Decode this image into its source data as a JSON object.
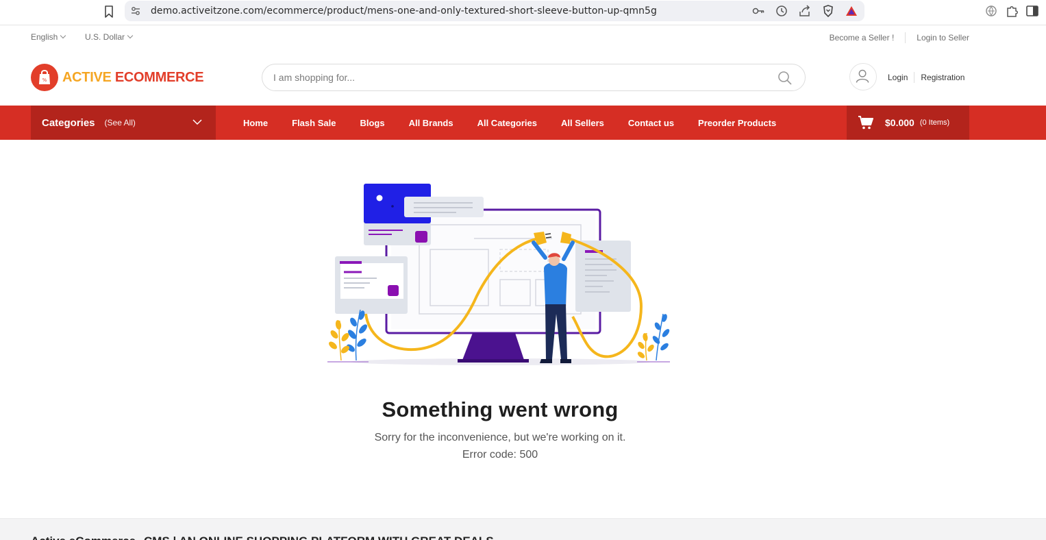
{
  "browser": {
    "url": "demo.activeitzone.com/ecommerce/product/mens-one-and-only-textured-short-sleeve-button-up-qmn5g"
  },
  "topbar": {
    "language": "English",
    "currency": "U.S. Dollar",
    "become_seller": "Become a Seller !",
    "login_seller": "Login to Seller"
  },
  "header": {
    "logo_part1": "ACTIVE",
    "logo_part2": "ECOMMERCE",
    "search_placeholder": "I am shopping for...",
    "login": "Login",
    "registration": "Registration"
  },
  "nav": {
    "categories_title": "Categories",
    "categories_see_all": "(See All)",
    "items": [
      "Home",
      "Flash Sale",
      "Blogs",
      "All Brands",
      "All Categories",
      "All Sellers",
      "Contact us",
      "Preorder Products"
    ],
    "cart_total": "$0.000",
    "cart_count": "(0 Items)"
  },
  "error": {
    "title": "Something went wrong",
    "message": "Sorry for the inconvenience, but we're working on it.",
    "code": "Error code: 500"
  },
  "footer": {
    "brand": "Active eCommerce",
    "tagline": "CMS | AN ONLINE SHOPPING PLATFORM WITH GREAT DEALS"
  },
  "colors": {
    "brand_red": "#d62e24",
    "brand_red_dark": "#b3241c",
    "logo_orange": "#f5a623",
    "illustration_purple": "#5a1ca3",
    "illustration_yellow": "#f5b61c",
    "illustration_blue": "#2f5fe0"
  }
}
